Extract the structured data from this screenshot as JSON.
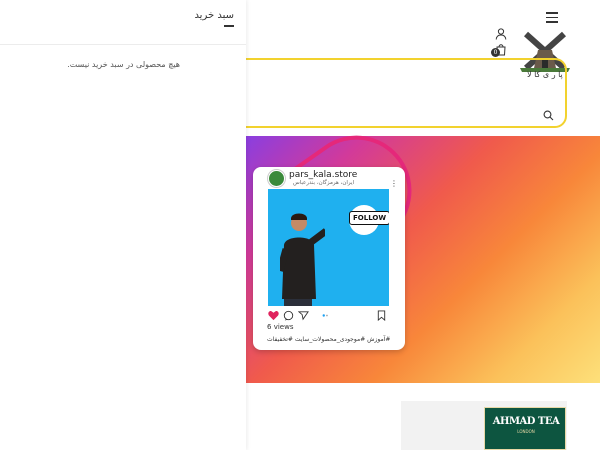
{
  "cart": {
    "title": "سبد خرید",
    "empty_message": "هیچ محصولی در سبد خرید نیست."
  },
  "header": {
    "logo_text": "پا ر ی کا لا",
    "cart_count": "0"
  },
  "post": {
    "username": "pars_kala.store",
    "location": "ایران، هرمزگان، بندرعباس",
    "more": "⋮",
    "follow": "FOLLOW",
    "views": "views",
    "views_count": "6",
    "tags": "#آموزش #موجودی_محصولات_سایت #تخفیفات"
  },
  "brand": {
    "name": "AHMAD TEA",
    "sub": "LONDON"
  },
  "colors": {
    "accent": "#f2d22e",
    "banner_loop": "#e5287a",
    "heart": "#e0245e",
    "brand_green": "#0d5540"
  }
}
